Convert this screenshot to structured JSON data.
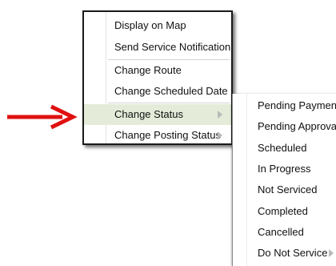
{
  "context_menu": {
    "items": [
      {
        "label": "Display on Map"
      },
      {
        "label": "Send Service Notification"
      },
      {
        "label": "Change Route"
      },
      {
        "label": "Change Scheduled Date"
      },
      {
        "label": "Change Status",
        "has_submenu": true,
        "highlighted": true
      },
      {
        "label": "Change Posting Status",
        "has_submenu": true
      }
    ]
  },
  "status_submenu": {
    "items": [
      {
        "label": "Pending Payment"
      },
      {
        "label": "Pending Approval"
      },
      {
        "label": "Scheduled"
      },
      {
        "label": "In Progress"
      },
      {
        "label": "Not Serviced"
      },
      {
        "label": "Completed"
      },
      {
        "label": "Cancelled"
      },
      {
        "label": "Do Not Service",
        "has_submenu": true
      }
    ]
  },
  "annotation": {
    "icon": "red-arrow-icon",
    "color": "#e01010"
  },
  "colors": {
    "highlight": "#e4ecd9",
    "border": "#1a1a1a"
  }
}
